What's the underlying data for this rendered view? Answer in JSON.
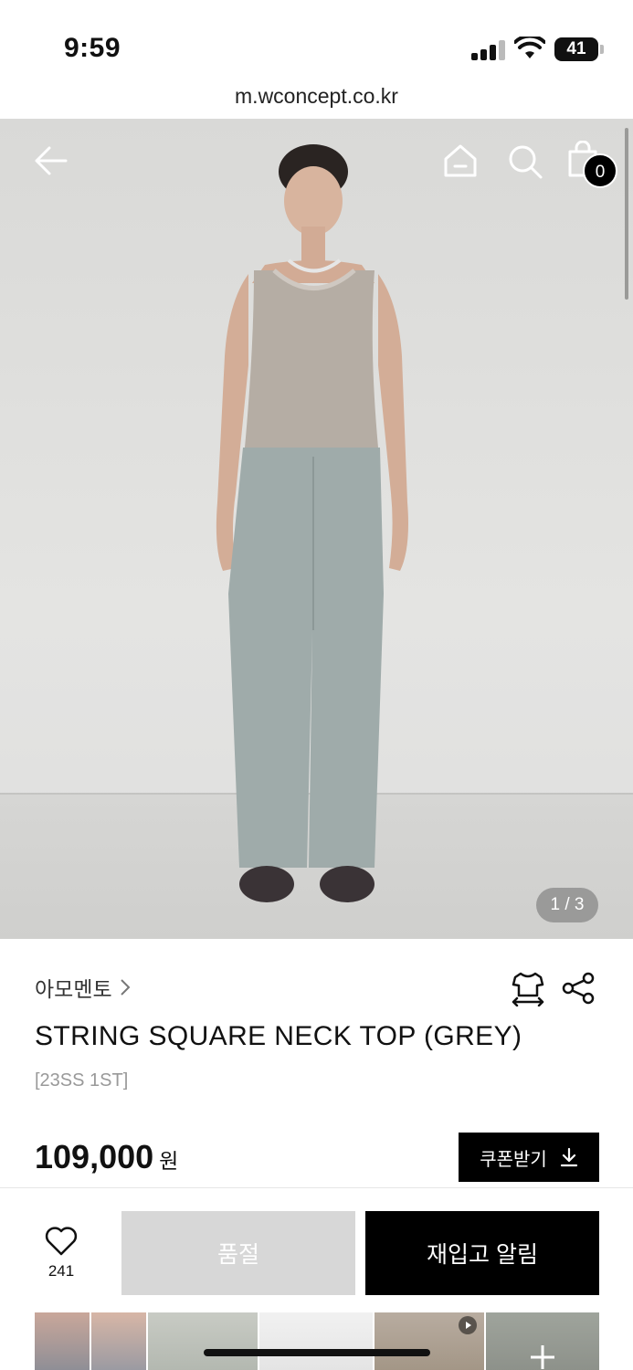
{
  "status": {
    "time": "9:59",
    "battery": "41"
  },
  "browser": {
    "url": "m.wconcept.co.kr"
  },
  "nav": {
    "cart_count": "0"
  },
  "gallery": {
    "indicator": "1 / 3",
    "current": 1,
    "total": 3
  },
  "product": {
    "brand": "아모멘토",
    "title": "STRING SQUARE NECK TOP (GREY)",
    "subtitle": "[23SS 1ST]",
    "price": "109,000",
    "currency": "원",
    "coupon_label": "쿠폰받기"
  },
  "bottom": {
    "wish_count": "241",
    "soldout_label": "품절",
    "restock_label": "재입고 알림"
  },
  "colors": {
    "accent": "#000000",
    "disabled": "#d7d7d7",
    "background": "#ffffff"
  },
  "icons": [
    "back-arrow-icon",
    "home-icon",
    "search-icon",
    "shopping-bag-icon",
    "chevron-right-icon",
    "size-fit-icon",
    "share-icon",
    "download-icon",
    "heart-icon",
    "play-icon",
    "plus-icon"
  ]
}
